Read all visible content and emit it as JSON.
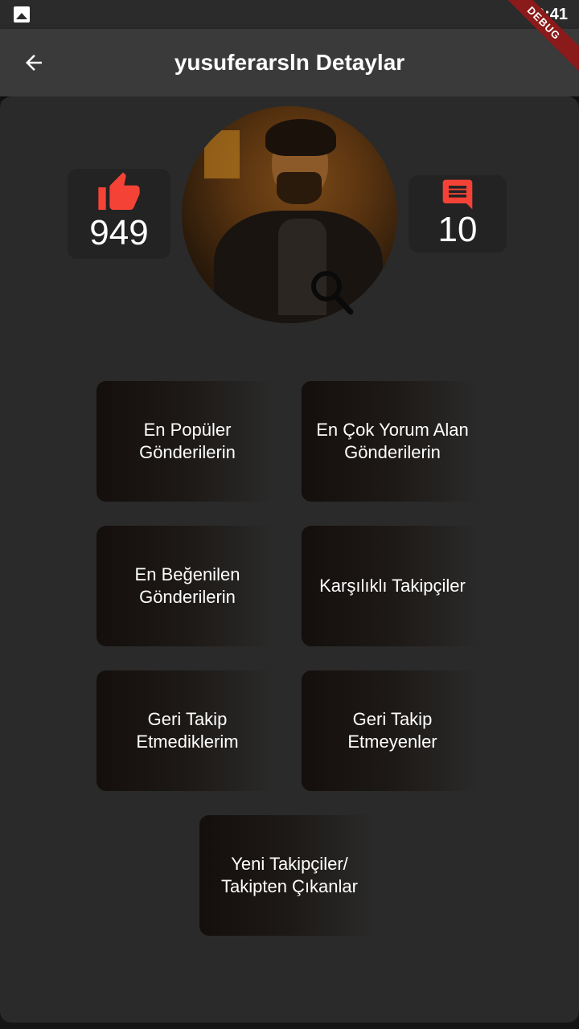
{
  "status_bar": {
    "time": "19:41",
    "debug_banner": "DEBUG",
    "gallery_icon": "image-icon"
  },
  "app_bar": {
    "title": "yusuferarsln Detaylar",
    "back_icon": "arrow-left-icon"
  },
  "stats": {
    "likes": {
      "icon": "thumbs-up-icon",
      "value": "949"
    },
    "comments": {
      "icon": "comment-icon",
      "value": "10"
    }
  },
  "profile": {
    "avatar_overlay_icon": "search-icon"
  },
  "menu": {
    "popular_posts": "En Popüler Gönderilerin",
    "most_commented": "En Çok Yorum Alan Gönderilerin",
    "most_liked": "En Beğenilen Gönderilerin",
    "mutual_followers": "Karşılıklı Takipçiler",
    "not_following_back": "Geri Takip Etmediklerim",
    "not_followed_back": "Geri Takip Etmeyenler",
    "new_followers_unfollowers": "Yeni Takipçiler/ Takipten Çıkanlar"
  },
  "colors": {
    "accent_red": "#f44336",
    "background": "#2a2a2a",
    "app_bar": "#3a3a3a"
  }
}
